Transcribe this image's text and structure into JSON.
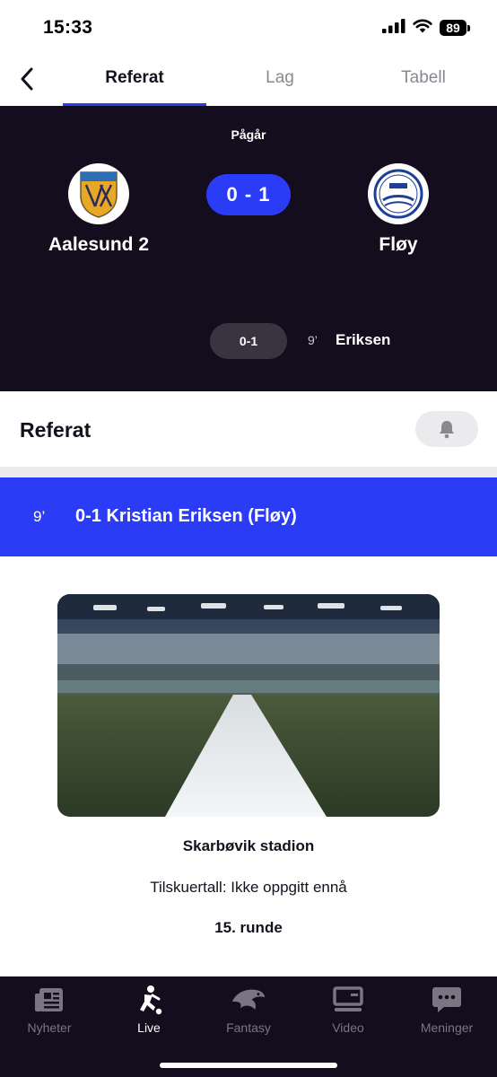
{
  "status_bar": {
    "time": "15:33",
    "battery": "89"
  },
  "tabs": {
    "items": [
      {
        "label": "Referat",
        "active": true
      },
      {
        "label": "Lag",
        "active": false
      },
      {
        "label": "Tabell",
        "active": false
      }
    ]
  },
  "match": {
    "status": "Pågår",
    "home_team": "Aalesund 2",
    "away_team": "Fløy",
    "score": "0 - 1",
    "goals": [
      {
        "score": "0-1",
        "minute": "9’",
        "scorer": "Eriksen"
      }
    ]
  },
  "referat": {
    "title": "Referat",
    "event": {
      "minute": "9’",
      "text": "0-1 Kristian Eriksen (Fløy)"
    }
  },
  "match_info": {
    "stadium": "Skarbøvik stadion",
    "spectators": "Tilskuertall: Ikke oppgitt ennå",
    "round": "15. runde"
  },
  "bottom_nav": {
    "items": [
      {
        "label": "Nyheter",
        "icon": "newspaper-icon",
        "active": false
      },
      {
        "label": "Live",
        "icon": "player-kicking-icon",
        "active": true
      },
      {
        "label": "Fantasy",
        "icon": "eagle-icon",
        "active": false
      },
      {
        "label": "Video",
        "icon": "video-screen-icon",
        "active": false
      },
      {
        "label": "Meninger",
        "icon": "chat-bubble-icon",
        "active": false
      }
    ]
  },
  "colors": {
    "accent": "#2a3cf6",
    "dark_background": "#130d1d",
    "inactive_nav": "#7b7583"
  }
}
